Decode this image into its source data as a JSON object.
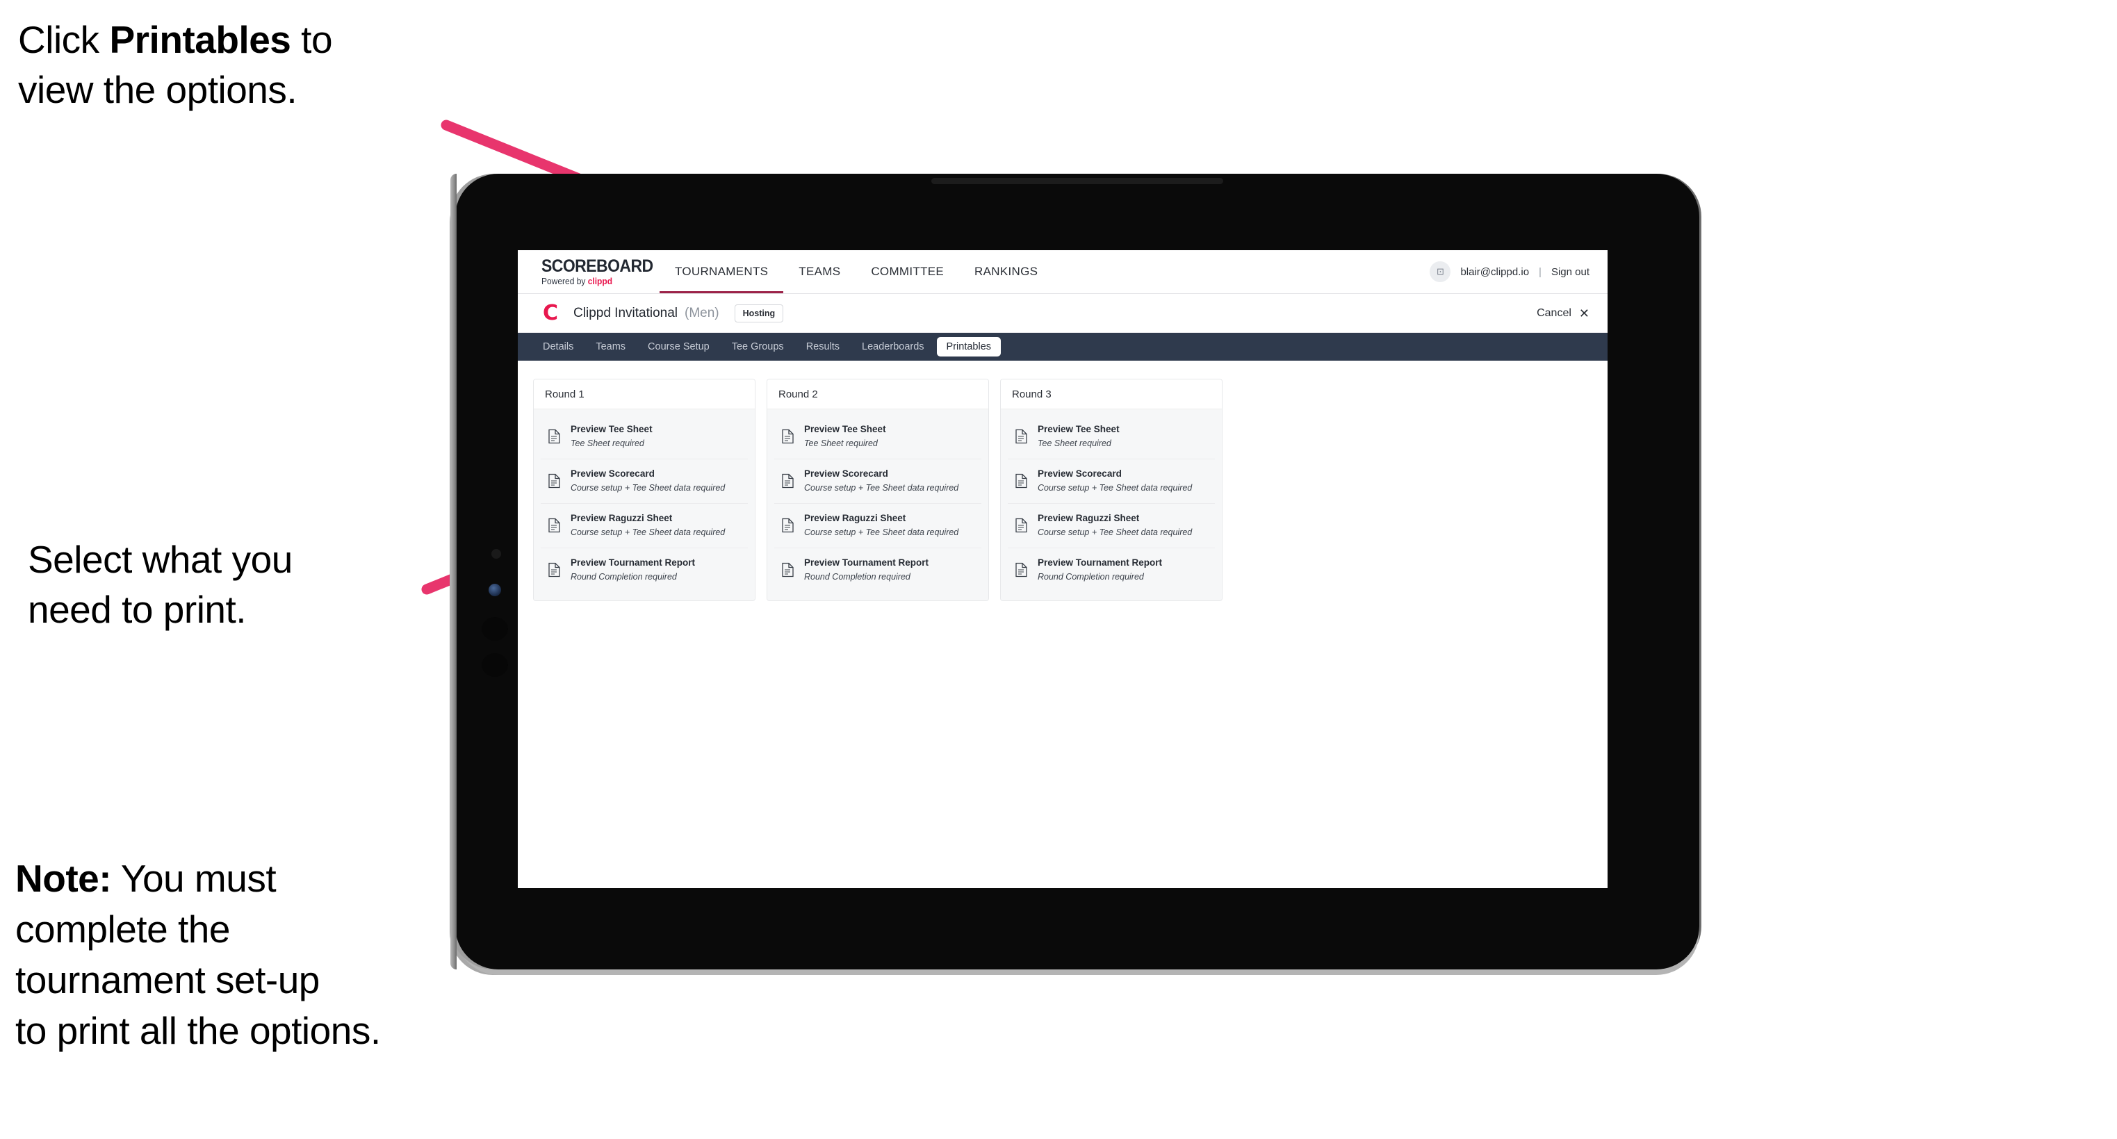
{
  "annotations": {
    "step1": "Click Printables to\nview the options.",
    "step1_plain_before": "Click ",
    "step1_bold": "Printables",
    "step1_plain_after": " to\nview the options.",
    "step2": "Select what you\n need to print.",
    "step3_bold": "Note:",
    "step3_rest": " You must\ncomplete the\ntournament set-up\nto print all the options.",
    "arrow_color": "#e8356d"
  },
  "app": {
    "brand": {
      "name": "SCOREBOARD",
      "powered_prefix": "Powered by ",
      "powered_brand": "clippd"
    },
    "main_nav": [
      {
        "label": "TOURNAMENTS",
        "active": true
      },
      {
        "label": "TEAMS",
        "active": false
      },
      {
        "label": "COMMITTEE",
        "active": false
      },
      {
        "label": "RANKINGS",
        "active": false
      }
    ],
    "account": {
      "avatar_glyph": "⊡",
      "email": "blair@clippd.io",
      "separator": "|",
      "sign_out": "Sign out"
    },
    "tournament": {
      "logo_letter": "C",
      "name": "Clippd Invitational",
      "gender": "(Men)",
      "badge": "Hosting",
      "cancel_label": "Cancel",
      "cancel_icon": "✕"
    },
    "sub_nav": [
      {
        "label": "Details",
        "active": false
      },
      {
        "label": "Teams",
        "active": false
      },
      {
        "label": "Course Setup",
        "active": false
      },
      {
        "label": "Tee Groups",
        "active": false
      },
      {
        "label": "Results",
        "active": false
      },
      {
        "label": "Leaderboards",
        "active": false
      },
      {
        "label": "Printables",
        "active": true
      }
    ],
    "rounds": [
      {
        "title": "Round 1",
        "items": [
          {
            "title": "Preview Tee Sheet",
            "subtitle": "Tee Sheet required"
          },
          {
            "title": "Preview Scorecard",
            "subtitle": "Course setup + Tee Sheet data required"
          },
          {
            "title": "Preview Raguzzi Sheet",
            "subtitle": "Course setup + Tee Sheet data required"
          },
          {
            "title": "Preview Tournament Report",
            "subtitle": "Round Completion required"
          }
        ]
      },
      {
        "title": "Round 2",
        "items": [
          {
            "title": "Preview Tee Sheet",
            "subtitle": "Tee Sheet required"
          },
          {
            "title": "Preview Scorecard",
            "subtitle": "Course setup + Tee Sheet data required"
          },
          {
            "title": "Preview Raguzzi Sheet",
            "subtitle": "Course setup + Tee Sheet data required"
          },
          {
            "title": "Preview Tournament Report",
            "subtitle": "Round Completion required"
          }
        ]
      },
      {
        "title": "Round 3",
        "items": [
          {
            "title": "Preview Tee Sheet",
            "subtitle": "Tee Sheet required"
          },
          {
            "title": "Preview Scorecard",
            "subtitle": "Course setup + Tee Sheet data required"
          },
          {
            "title": "Preview Raguzzi Sheet",
            "subtitle": "Course setup + Tee Sheet data required"
          },
          {
            "title": "Preview Tournament Report",
            "subtitle": "Round Completion required"
          }
        ]
      }
    ],
    "colors": {
      "brand_pink": "#e8174e",
      "subnav_bg": "#2f3a4d",
      "active_underline": "#9c2348"
    }
  }
}
